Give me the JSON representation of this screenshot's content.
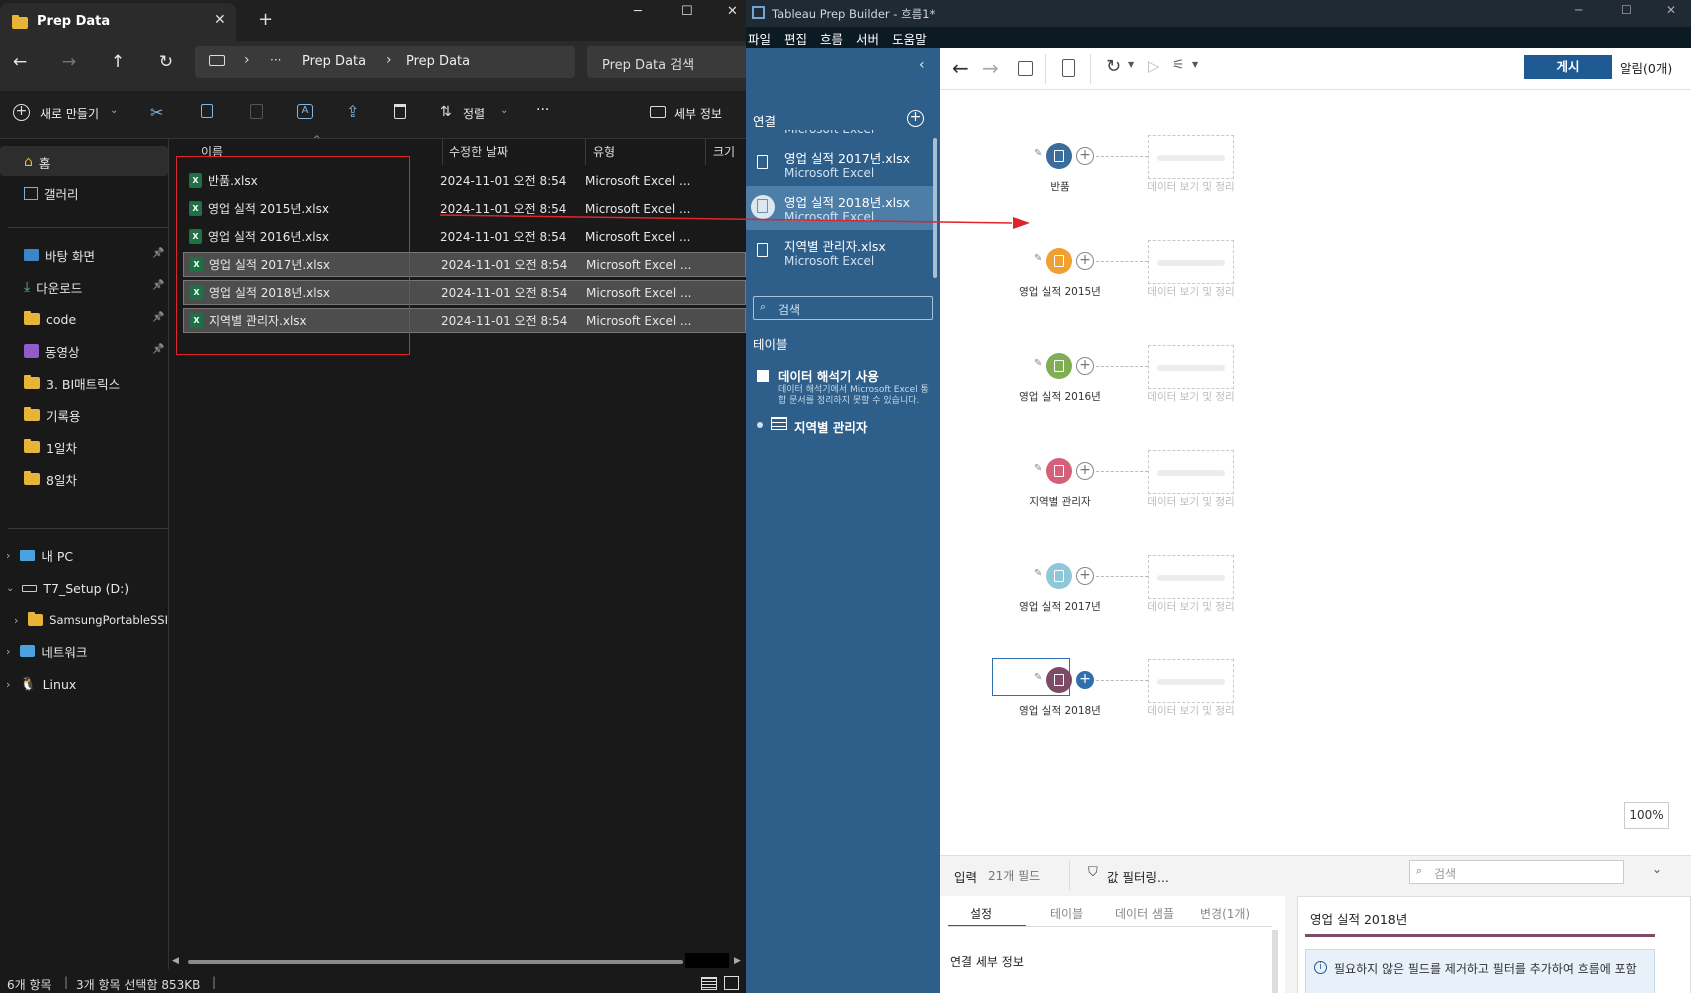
{
  "explorer": {
    "tab_title": "Prep Data",
    "new_tab": "+",
    "window": {
      "minimize": "─",
      "maximize": "☐",
      "close": "✕"
    },
    "breadcrumb": [
      "Prep Data",
      "Prep Data"
    ],
    "ellipsis": "···",
    "search_placeholder": "Prep Data 검색",
    "commands": {
      "new": "새로 만들기",
      "sort": "정렬",
      "more": "···",
      "details": "세부 정보"
    },
    "columns": {
      "name": "이름",
      "modified": "수정한 날짜",
      "type": "유형",
      "size": "크기"
    },
    "sidebar": {
      "top": [
        {
          "label": "홈"
        },
        {
          "label": "갤러리"
        }
      ],
      "quick": [
        {
          "label": "바탕 화면"
        },
        {
          "label": "다운로드"
        },
        {
          "label": "code"
        },
        {
          "label": "동영상"
        },
        {
          "label": "3. BI매트릭스"
        },
        {
          "label": "기록용"
        },
        {
          "label": "1일차"
        },
        {
          "label": "8일차"
        }
      ],
      "tree": [
        {
          "label": "내 PC"
        },
        {
          "label": "T7_Setup (D:)"
        },
        {
          "label": "SamsungPortableSSI"
        },
        {
          "label": "네트워크"
        },
        {
          "label": "Linux"
        }
      ]
    },
    "files": [
      {
        "name": "반품.xlsx",
        "modified": "2024-11-01 오전 8:54",
        "type": "Microsoft Excel ..."
      },
      {
        "name": "영업 실적 2015년.xlsx",
        "modified": "2024-11-01 오전 8:54",
        "type": "Microsoft Excel ..."
      },
      {
        "name": "영업 실적 2016년.xlsx",
        "modified": "2024-11-01 오전 8:54",
        "type": "Microsoft Excel ..."
      },
      {
        "name": "영업 실적 2017년.xlsx",
        "modified": "2024-11-01 오전 8:54",
        "type": "Microsoft Excel ..."
      },
      {
        "name": "영업 실적 2018년.xlsx",
        "modified": "2024-11-01 오전 8:54",
        "type": "Microsoft Excel ..."
      },
      {
        "name": "지역별 관리자.xlsx",
        "modified": "2024-11-01 오전 8:54",
        "type": "Microsoft Excel ..."
      }
    ],
    "status": {
      "count": "6개 항목",
      "selection": "3개 항목 선택함 853KB"
    }
  },
  "tableau": {
    "title": "Tableau Prep Builder - 흐름1*",
    "menu": [
      "파일",
      "편집",
      "흐름",
      "서버",
      "도움말"
    ],
    "publish": "게시",
    "alerts": "알림(0개)",
    "zoom": "100%",
    "sidebar": {
      "connections_label": "연결",
      "partial_type": "Microsoft Excel",
      "connections": [
        {
          "name": "영업 실적 2017년.xlsx",
          "type": "Microsoft Excel"
        },
        {
          "name": "영업 실적 2018년.xlsx",
          "type": "Microsoft Excel"
        },
        {
          "name": "지역별 관리자.xlsx",
          "type": "Microsoft Excel"
        }
      ],
      "search_placeholder": "검색",
      "tables_label": "테이블",
      "interpreter_label": "데이터 해석기 사용",
      "interpreter_desc": "데이터 해석기에서 Microsoft Excel 통합 문서를 정리하지 못할 수 있습니다.",
      "table_name": "지역별 관리자"
    },
    "flow": {
      "ghost_label": "데이터 보기 및 정리",
      "nodes": [
        {
          "label": "반품",
          "color": "#3a6e9a"
        },
        {
          "label": "영업 실적 2015년",
          "color": "#f0a030"
        },
        {
          "label": "영업 실적 2016년",
          "color": "#7fae55"
        },
        {
          "label": "지역별 관리자",
          "color": "#d5607a"
        },
        {
          "label": "영업 실적 2017년",
          "color": "#8ec8d8"
        },
        {
          "label": "영업 실적 2018년",
          "color": "#7d4a68"
        }
      ]
    },
    "bottom": {
      "input_label": "입력",
      "field_count": "21개 필드",
      "filter_label": "값 필터링...",
      "search_placeholder": "검색",
      "tabs": [
        "설정",
        "테이블",
        "데이터 샘플",
        "변경(1개)"
      ],
      "connection_details": "연결 세부 정보",
      "panel_title": "영업 실적 2018년",
      "info_text": "필요하지 않은 필드를 제거하고 필터를 추가하여 흐름에 포함"
    }
  }
}
